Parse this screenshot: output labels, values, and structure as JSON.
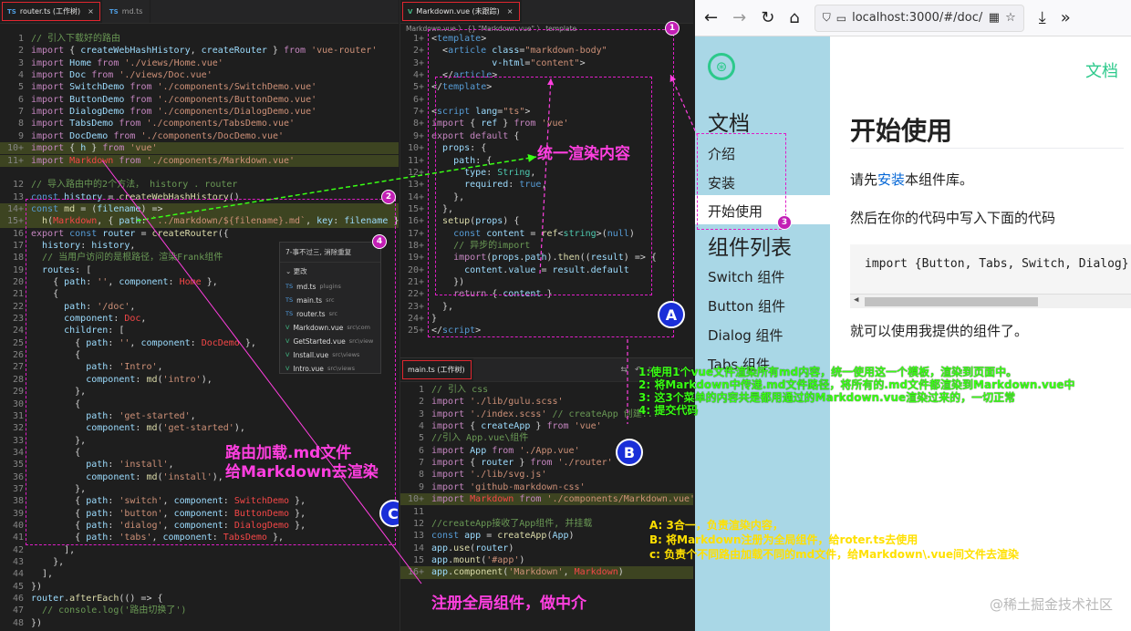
{
  "left_editor": {
    "tabs": [
      {
        "icon": "TS",
        "label": "router.ts (工作树)",
        "active": true
      },
      {
        "icon": "TS",
        "label": "md.ts",
        "active": false
      }
    ],
    "lines": [
      {
        "n": "1",
        "h": "<span class='c'>// 引入下载好的路由</span>"
      },
      {
        "n": "2",
        "h": "<span class='k'>import</span> { <span class='v'>createWebHashHistory</span>, <span class='v'>createRouter</span> } <span class='k'>from</span> <span class='s'>'vue-router'</span>"
      },
      {
        "n": "3",
        "h": "<span class='k'>import</span> <span class='v'>Home</span> <span class='k'>from</span> <span class='s'>'./views/Home.vue'</span>"
      },
      {
        "n": "4",
        "h": "<span class='k'>import</span> <span class='v'>Doc</span> <span class='k'>from</span> <span class='s'>'./views/Doc.vue'</span>"
      },
      {
        "n": "5",
        "h": "<span class='k'>import</span> <span class='v'>SwitchDemo</span> <span class='k'>from</span> <span class='s'>'./components/SwitchDemo.vue'</span>"
      },
      {
        "n": "6",
        "h": "<span class='k'>import</span> <span class='v'>ButtonDemo</span> <span class='k'>from</span> <span class='s'>'./components/ButtonDemo.vue'</span>"
      },
      {
        "n": "7",
        "h": "<span class='k'>import</span> <span class='v'>DialogDemo</span> <span class='k'>from</span> <span class='s'>'./components/DialogDemo.vue'</span>"
      },
      {
        "n": "8",
        "h": "<span class='k'>import</span> <span class='v'>TabsDemo</span> <span class='k'>from</span> <span class='s'>'./components/TabsDemo.vue'</span>"
      },
      {
        "n": "9",
        "h": "<span class='k'>import</span> <span class='v'>DocDemo</span> <span class='k'>from</span> <span class='s'>'./components/DocDemo.vue'</span>"
      },
      {
        "n": "10+",
        "hl": true,
        "h": "<span class='k'>import</span> { <span class='v'>h</span> } <span class='k'>from</span> <span class='s'>'vue'</span>"
      },
      {
        "n": "11+",
        "hl": true,
        "h": "<span class='k'>import</span> <span class='r'>Markdown</span> <span class='k'>from</span> <span class='s'>'./components/Markdown.vue'</span>"
      },
      {
        "n": "",
        "h": ""
      },
      {
        "n": "12",
        "h": "<span class='c'>// 导入路由中的2个方法， history . router</span>"
      },
      {
        "n": "13",
        "h": "<span class='b'>const</span> <span class='v'>history</span> = <span class='f'>createWebHashHistory</span>()"
      },
      {
        "n": "14+",
        "hl": true,
        "h": "<span class='b'>const</span> <span class='f'>md</span> = (<span class='v'>filename</span>) =&gt;"
      },
      {
        "n": "15+",
        "hl": true,
        "h": "  <span class='f'>h</span>(<span class='r'>Markdown</span>, { <span class='v'>path</span>: <span class='s'>`../markdown/${filename}.md`</span>, <span class='v'>key</span>: <span class='v'>filename</span> })"
      },
      {
        "n": "16",
        "h": "<span class='k'>export</span> <span class='b'>const</span> <span class='v'>router</span> = <span class='f'>createRouter</span>({"
      },
      {
        "n": "17",
        "h": "  <span class='v'>history</span>: <span class='v'>history</span>,"
      },
      {
        "n": "18",
        "h": "  <span class='c'>// 当用户访问的是根路径，渲染Frank组件</span>"
      },
      {
        "n": "19",
        "h": "  <span class='v'>routes</span>: ["
      },
      {
        "n": "20",
        "h": "    { <span class='v'>path</span>: <span class='s'>''</span>, <span class='v'>component</span>: <span class='r'>Home</span> },"
      },
      {
        "n": "21",
        "h": "    {"
      },
      {
        "n": "22",
        "h": "      <span class='v'>path</span>: <span class='s'>'/doc'</span>,"
      },
      {
        "n": "23",
        "h": "      <span class='v'>component</span>: <span class='r'>Doc</span>,"
      },
      {
        "n": "24",
        "h": "      <span class='v'>children</span>: ["
      },
      {
        "n": "25",
        "h": "        { <span class='v'>path</span>: <span class='s'>''</span>, <span class='v'>component</span>: <span class='r'>DocDemo</span> },"
      },
      {
        "n": "26",
        "h": "        {"
      },
      {
        "n": "27",
        "h": "          <span class='v'>path</span>: <span class='s'>'Intro'</span>,"
      },
      {
        "n": "28",
        "h": "          <span class='v'>component</span>: <span class='f'>md</span>(<span class='s'>'intro'</span>),"
      },
      {
        "n": "29",
        "h": "        },"
      },
      {
        "n": "30",
        "h": "        {"
      },
      {
        "n": "31",
        "h": "          <span class='v'>path</span>: <span class='s'>'get-started'</span>,"
      },
      {
        "n": "32",
        "h": "          <span class='v'>component</span>: <span class='f'>md</span>(<span class='s'>'get-started'</span>),"
      },
      {
        "n": "33",
        "h": "        },"
      },
      {
        "n": "34",
        "h": "        {"
      },
      {
        "n": "35",
        "h": "          <span class='v'>path</span>: <span class='s'>'install'</span>,"
      },
      {
        "n": "36",
        "h": "          <span class='v'>component</span>: <span class='f'>md</span>(<span class='s'>'install'</span>),"
      },
      {
        "n": "37",
        "h": "        },"
      },
      {
        "n": "38",
        "h": "        { <span class='v'>path</span>: <span class='s'>'switch'</span>, <span class='v'>component</span>: <span class='r'>SwitchDemo</span> },"
      },
      {
        "n": "39",
        "h": "        { <span class='v'>path</span>: <span class='s'>'button'</span>, <span class='v'>component</span>: <span class='r'>ButtonDemo</span> },"
      },
      {
        "n": "40",
        "h": "        { <span class='v'>path</span>: <span class='s'>'dialog'</span>, <span class='v'>component</span>: <span class='r'>DialogDemo</span> },"
      },
      {
        "n": "41",
        "h": "        { <span class='v'>path</span>: <span class='s'>'tabs'</span>, <span class='v'>component</span>: <span class='r'>TabsDemo</span> },"
      },
      {
        "n": "42",
        "h": "      ],"
      },
      {
        "n": "43",
        "h": "    },"
      },
      {
        "n": "44",
        "h": "  ],"
      },
      {
        "n": "45",
        "h": "})"
      },
      {
        "n": "46",
        "h": "<span class='v'>router</span>.<span class='f'>afterEach</span>(() =&gt; {"
      },
      {
        "n": "47",
        "h": "  <span class='c'>// console.log('路由切换了')</span>"
      },
      {
        "n": "48",
        "h": "})"
      }
    ],
    "popup": {
      "title": "7-事不过三, 消除重复",
      "section": "更改",
      "items": [
        {
          "icon": "TS",
          "name": "md.ts",
          "path": "plugins"
        },
        {
          "icon": "TS",
          "name": "main.ts",
          "path": "src"
        },
        {
          "icon": "TS",
          "name": "router.ts",
          "path": "src"
        },
        {
          "icon": "V",
          "name": "Markdown.vue",
          "path": "src\\com"
        },
        {
          "icon": "V",
          "name": "GetStarted.vue",
          "path": "src\\view"
        },
        {
          "icon": "V",
          "name": "Install.vue",
          "path": "src\\views"
        },
        {
          "icon": "V",
          "name": "Intro.vue",
          "path": "src\\views"
        }
      ]
    }
  },
  "mid_top": {
    "tab": "Markdown.vue (未跟踪)",
    "breadcrumb": "Markdown.vue 〉 {} \"Markdown.vue\" 〉 template",
    "lines": [
      {
        "n": "1+",
        "h": "&lt;<span class='b'>template</span>&gt;"
      },
      {
        "n": "2+",
        "h": "  &lt;<span class='b'>article</span> <span class='v'>class</span>=<span class='s'>\"markdown-body\"</span>"
      },
      {
        "n": "3+",
        "h": "           <span class='v'>v-html</span>=<span class='s'>\"content\"</span>&gt;"
      },
      {
        "n": "4+",
        "h": "  &lt;/<span class='b'>article</span>&gt;"
      },
      {
        "n": "5+",
        "h": "&lt;/<span class='b'>template</span>&gt;"
      },
      {
        "n": "6+",
        "h": ""
      },
      {
        "n": "7+",
        "h": "&lt;<span class='b'>script</span> <span class='v'>lang</span>=<span class='s'>\"ts\"</span>&gt;"
      },
      {
        "n": "8+",
        "h": "<span class='k'>import</span> { <span class='v'>ref</span> } <span class='k'>from</span> <span class='s'>'vue'</span>"
      },
      {
        "n": "9+",
        "h": "<span class='k'>export</span> <span class='k'>default</span> {"
      },
      {
        "n": "10+",
        "h": "  <span class='v'>props</span>: {"
      },
      {
        "n": "11+",
        "h": "    <span class='v'>path</span>: {"
      },
      {
        "n": "12+",
        "h": "      <span class='v'>type</span>: <span class='t'>String</span>,"
      },
      {
        "n": "13+",
        "h": "      <span class='v'>required</span>: <span class='b'>true</span>,"
      },
      {
        "n": "14+",
        "h": "    },"
      },
      {
        "n": "15+",
        "h": "  },"
      },
      {
        "n": "16+",
        "h": "  <span class='f'>setup</span>(<span class='v'>props</span>) {"
      },
      {
        "n": "17+",
        "h": "    <span class='b'>const</span> <span class='v'>content</span> = <span class='f'>ref</span>&lt;<span class='t'>string</span>&gt;(<span class='b'>null</span>)"
      },
      {
        "n": "18+",
        "h": "    <span class='c'>// 异步的import</span>"
      },
      {
        "n": "19+",
        "h": "    <span class='k'>import</span>(<span class='v'>props</span>.<span class='v'>path</span>).<span class='f'>then</span>((<span class='v'>result</span>) =&gt; {"
      },
      {
        "n": "20+",
        "h": "      <span class='v'>content</span>.<span class='v'>value</span> = <span class='v'>result</span>.<span class='v'>default</span>"
      },
      {
        "n": "21+",
        "h": "    })"
      },
      {
        "n": "22+",
        "h": "    <span class='k'>return</span> { <span class='v'>content</span> }"
      },
      {
        "n": "23+",
        "h": "  },"
      },
      {
        "n": "24+",
        "h": "}"
      },
      {
        "n": "25+",
        "h": "&lt;/<span class='b'>script</span>&gt;"
      }
    ]
  },
  "mid_bottom": {
    "tab": "main.ts (工作树)",
    "lines": [
      {
        "n": "1",
        "h": "<span class='c'>// 引入 css</span>"
      },
      {
        "n": "2",
        "h": "<span class='k'>import</span> <span class='s'>'./lib/gulu.scss'</span>"
      },
      {
        "n": "3",
        "h": "<span class='k'>import</span> <span class='s'>'./index.scss'</span> <span class='c'>// createApp 创建...</span>"
      },
      {
        "n": "4",
        "h": "<span class='k'>import</span> { <span class='v'>createApp</span> } <span class='k'>from</span> <span class='s'>'vue'</span>"
      },
      {
        "n": "5",
        "h": "<span class='c'>//引入 App.vue\\组件</span>"
      },
      {
        "n": "6",
        "h": "<span class='k'>import</span> <span class='v'>App</span> <span class='k'>from</span> <span class='s'>'./App.vue'</span>"
      },
      {
        "n": "7",
        "h": "<span class='k'>import</span> { <span class='v'>router</span> } <span class='k'>from</span> <span class='s'>'./router'</span>"
      },
      {
        "n": "8",
        "h": "<span class='k'>import</span> <span class='s'>'./lib/svg.js'</span>"
      },
      {
        "n": "9",
        "h": "<span class='k'>import</span> <span class='s'>'github-markdown-css'</span>"
      },
      {
        "n": "10+",
        "hl": true,
        "h": "<span class='k'>import</span> <span class='r'>Markdown</span> <span class='k'>from</span> <span class='s'>'./components/Markdown.vue'</span>"
      },
      {
        "n": "11",
        "h": ""
      },
      {
        "n": "12",
        "h": "<span class='c'>//createApp接收了App组件, 并挂载</span>"
      },
      {
        "n": "13",
        "h": "<span class='b'>const</span> <span class='v'>app</span> = <span class='f'>createApp</span>(<span class='v'>App</span>)"
      },
      {
        "n": "14",
        "h": "<span class='v'>app</span>.<span class='f'>use</span>(<span class='v'>router</span>)"
      },
      {
        "n": "15",
        "h": "<span class='v'>app</span>.<span class='f'>mount</span>(<span class='s'>'#app'</span>)"
      },
      {
        "n": "16+",
        "hl": true,
        "h": "<span class='v'>app</span>.<span class='f'>component</span>(<span class='s'>'Markdown'</span>, <span class='r'>Markdown</span>)"
      }
    ]
  },
  "browser": {
    "url": "localhost:3000/#/doc/",
    "nav_right_link": "文档",
    "sidebar": {
      "doc_heading": "文档",
      "doc_items": [
        "介绍",
        "安装",
        "开始使用"
      ],
      "components_heading": "组件列表",
      "component_items": [
        "Switch 组件",
        "Button 组件",
        "Dialog 组件",
        "Tabs 组件"
      ]
    },
    "content": {
      "title": "开始使用",
      "p1_prefix": "请先",
      "p1_link": "安装",
      "p1_suffix": "本组件库。",
      "p2": "然后在你的代码中写入下面的代码",
      "code": "import {Button, Tabs, Switch, Dialog}",
      "p3": "就可以使用我提供的组件了。"
    },
    "watermark": "@稀土掘金技术社区"
  },
  "annotations": {
    "unified_render": "统一渲染内容",
    "route_load_line1": "路由加载.md文件",
    "route_load_line2": "给Markdown去渲染",
    "register_global": "注册全局组件，做中介",
    "notes_green": [
      "1:使用1个vue文件渲染所有md内容，统一使用这一个模板，渲染到页面中。",
      "2: 将Markdown中传递.md文件路径，将所有的.md文件都渲染到Markdown.vue中",
      "3: 这3个菜单的内容共是都用通过的Markdown.vue渲染过来的，一切正常",
      "4: 提交代码"
    ],
    "notes_yellow": [
      "A:  3合一，负责渲染内容，",
      "B:  将Markdown注册为全局组件，给roter.ts去使用",
      "c:  负责个不同路由加载不同的md文件，给Markdown\\.vue间文件去渲染"
    ],
    "markers": [
      "A",
      "B",
      "C",
      "1",
      "2",
      "3",
      "4"
    ]
  }
}
